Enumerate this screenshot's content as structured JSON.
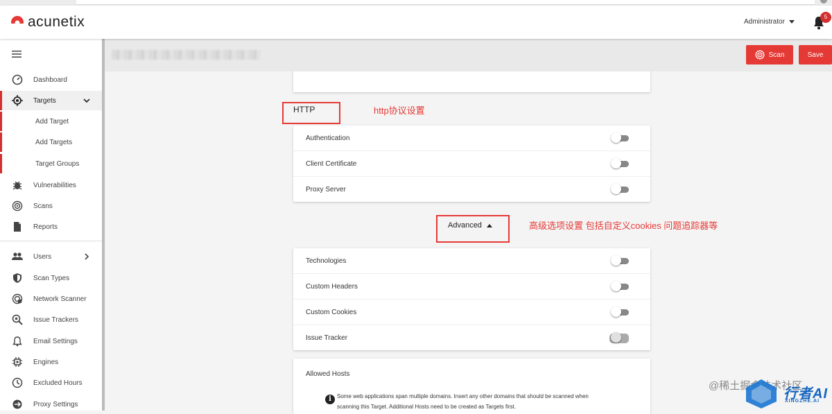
{
  "header": {
    "brand": "acunetix",
    "user": "Administrator",
    "notification_count": "5"
  },
  "sidebar": {
    "items": [
      {
        "label": "Dashboard",
        "icon": "dashboard-gauge-icon"
      },
      {
        "label": "Targets",
        "icon": "target-icon",
        "active": true
      },
      {
        "label": "Add Target"
      },
      {
        "label": "Add Targets"
      },
      {
        "label": "Target Groups"
      },
      {
        "label": "Vulnerabilities",
        "icon": "bug-icon"
      },
      {
        "label": "Scans",
        "icon": "scan-radar-icon"
      },
      {
        "label": "Reports",
        "icon": "report-document-icon"
      },
      {
        "label": "Users",
        "icon": "users-icon"
      },
      {
        "label": "Scan Types",
        "icon": "shield-icon"
      },
      {
        "label": "Network Scanner",
        "icon": "network-scanner-icon"
      },
      {
        "label": "Issue Trackers",
        "icon": "issue-tracker-icon"
      },
      {
        "label": "Email Settings",
        "icon": "bell-icon"
      },
      {
        "label": "Engines",
        "icon": "engine-chip-icon"
      },
      {
        "label": "Excluded Hours",
        "icon": "clock-icon"
      },
      {
        "label": "Proxy Settings",
        "icon": "proxy-icon"
      }
    ]
  },
  "toolbar": {
    "scan_label": "Scan",
    "save_label": "Save"
  },
  "http_section": {
    "title": "HTTP",
    "annotation": "http协议设置",
    "rows": [
      {
        "label": "Authentication",
        "enabled": false
      },
      {
        "label": "Client Certificate",
        "enabled": false
      },
      {
        "label": "Proxy Server",
        "enabled": false
      }
    ]
  },
  "advanced": {
    "label": "Advanced",
    "annotation": "高级选项设置 包括自定义cookies 问题追踪器等",
    "rows": [
      {
        "label": "Technologies",
        "enabled": false
      },
      {
        "label": "Custom Headers",
        "enabled": false
      },
      {
        "label": "Custom Cookies",
        "enabled": false
      },
      {
        "label": "Issue Tracker",
        "enabled": false
      }
    ]
  },
  "allowed_hosts": {
    "title": "Allowed Hosts",
    "info": "Some web applications span multiple domains. Insert any other domains that should be scanned when scanning this Target. Additional Hosts need to be created as Targets first."
  },
  "watermark": {
    "text": "@稀土掘金技术社区",
    "brand": "行者AI",
    "brand_sub": "XINGZHE.AI"
  },
  "colors": {
    "accent": "#e53935",
    "badge": "#d32f2f",
    "watermark_brand": "#1565c0"
  }
}
